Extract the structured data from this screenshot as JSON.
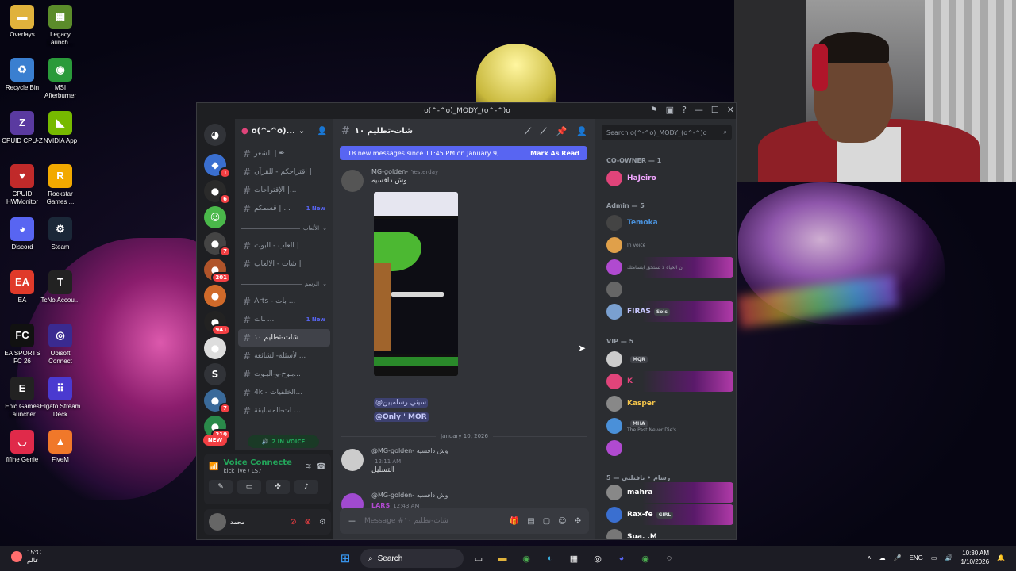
{
  "desktop": {
    "icons": [
      {
        "label": "Overlays",
        "icon": "folder-icon",
        "color": "#e0b23c",
        "glyph": "▬"
      },
      {
        "label": "Legacy Launch...",
        "icon": "minecraft-icon",
        "color": "#5b8c2a",
        "glyph": "▦"
      },
      {
        "label": "Recycle Bin",
        "icon": "recycle-bin-icon",
        "color": "#3a7fd0",
        "glyph": "♻"
      },
      {
        "label": "MSI Afterburner",
        "icon": "afterburner-icon",
        "color": "#2a9a3a",
        "glyph": "◉"
      },
      {
        "label": "CPUID CPU-Z",
        "icon": "cpuz-icon",
        "color": "#5a3aa0",
        "glyph": "Z"
      },
      {
        "label": "NVIDIA App",
        "icon": "nvidia-icon",
        "color": "#76b900",
        "glyph": "◣"
      },
      {
        "label": "CPUID HWMonitor",
        "icon": "hwmonitor-icon",
        "color": "#c02a2a",
        "glyph": "♥"
      },
      {
        "label": "Rockstar Games ...",
        "icon": "rockstar-icon",
        "color": "#f2a900",
        "glyph": "R"
      },
      {
        "label": "Discord",
        "icon": "discord-icon",
        "color": "#5865f2",
        "glyph": "◕"
      },
      {
        "label": "Steam",
        "icon": "steam-icon",
        "color": "#1b2838",
        "glyph": "⚙"
      },
      {
        "label": "EA",
        "icon": "ea-icon",
        "color": "#e03a2a",
        "glyph": "EA"
      },
      {
        "label": "TcNo Accou...",
        "icon": "tcno-icon",
        "color": "#222222",
        "glyph": "T"
      },
      {
        "label": "EA SPORTS FC 26",
        "icon": "fc26-icon",
        "color": "#111111",
        "glyph": "FC"
      },
      {
        "label": "Ubisoft Connect",
        "icon": "ubisoft-icon",
        "color": "#3a2a90",
        "glyph": "◎"
      },
      {
        "label": "Epic Games Launcher",
        "icon": "epic-icon",
        "color": "#222222",
        "glyph": "E"
      },
      {
        "label": "Elgato Stream Deck",
        "icon": "streamdeck-icon",
        "color": "#4a3ad0",
        "glyph": "⠿"
      },
      {
        "label": "fifine Genie",
        "icon": "fifine-icon",
        "color": "#e02a4a",
        "glyph": "◡"
      },
      {
        "label": "FiveM",
        "icon": "fivem-icon",
        "color": "#f0782a",
        "glyph": "▲"
      }
    ]
  },
  "window": {
    "title": "o(^-^o)_MODY_(o^-^)o"
  },
  "guild": {
    "name": "o(^-^o)..."
  },
  "servers": [
    {
      "badge": "1",
      "color": "#3a6fd0",
      "glyph": "◆"
    },
    {
      "badge": "6",
      "color": "#2a2a2a",
      "glyph": "●"
    },
    {
      "badge": "",
      "color": "#4ab84a",
      "glyph": "☺"
    },
    {
      "badge": "7",
      "color": "#444444",
      "glyph": "●"
    },
    {
      "badge": "201",
      "color": "#b0542a",
      "glyph": "●"
    },
    {
      "badge": "",
      "color": "#d06a2a",
      "glyph": "●"
    },
    {
      "badge": "941",
      "color": "#222222",
      "glyph": "●"
    },
    {
      "badge": "",
      "color": "#dddddd",
      "glyph": "●"
    },
    {
      "badge": "",
      "color": "#313338",
      "glyph": "S"
    },
    {
      "badge": "7",
      "color": "#3a6a9a",
      "glyph": "●"
    },
    {
      "badge": "210",
      "color": "#2a8a4a",
      "glyph": "●"
    }
  ],
  "rail_new": "NEW",
  "channels": [
    {
      "name": "الشعر | ✒",
      "active": false,
      "new": ""
    },
    {
      "name": "اقتراحكم - للقرآن |",
      "active": false,
      "new": ""
    },
    {
      "name": "الإقتراحات |...",
      "active": false,
      "new": ""
    },
    {
      "name": "قسمكم | ...",
      "active": false,
      "new": "1 New"
    }
  ],
  "category1": "الألعاب",
  "channels2": [
    {
      "name": "العاب - البوت |",
      "active": false,
      "new": ""
    },
    {
      "name": "شات - الالعاب |",
      "active": false,
      "new": ""
    }
  ],
  "category2": "الرسم",
  "channels3": [
    {
      "name": "Arts - بات ...",
      "active": false,
      "new": ""
    },
    {
      "name": "ـات ...",
      "active": false,
      "new": "1 New"
    },
    {
      "name": "شات-تطليم ١٠",
      "active": true,
      "new": ""
    },
    {
      "name": "الأسئلة-الشائعة...",
      "active": false,
      "new": ""
    },
    {
      "name": "بـوح-و-البـوت...",
      "active": false,
      "new": ""
    },
    {
      "name": "4k - الخلفيات...",
      "active": false,
      "new": ""
    },
    {
      "name": "ـات-المسابقة...",
      "active": false,
      "new": ""
    }
  ],
  "voice_pill": "2 IN VOICE",
  "voice": {
    "title": "Voice Connecte",
    "subtitle": "kick live / LS7"
  },
  "user": {
    "name": "محمد"
  },
  "chat": {
    "channel_name": "شات-تطليم ١٠",
    "new_banner": "18 new messages since 11:45 PM on January 9, ...",
    "mark_read": "Mark As Read",
    "msg1_author": "MG-golden-",
    "msg1_time": "Yesterday",
    "msg1_text": "وش دافسيه",
    "mention1": "@سيني رساميين",
    "mention2": "@Only ' MOR",
    "date_divider": "January 10, 2026",
    "msg2_reply": "@MG-golden- وش دافسيه",
    "msg2_time": "12:11 AM",
    "msg2_text": "التسليل",
    "msg3_reply": "@MG-golden- وش دافسيه",
    "msg3_author": "LARS",
    "msg3_time": "12:43 AM",
    "composer_placeholder": "Message #شات-تطليم ١٠"
  },
  "members": {
    "search_placeholder": "Search o(^-^o)_MODY_(o^-^)o",
    "groups": [
      {
        "label": "CO-OWNER — 1"
      },
      {
        "label": "Admin — 5"
      },
      {
        "label": "VIP — 5"
      },
      {
        "label": "رسام • بافتلتي — 5"
      }
    ],
    "list": [
      {
        "name": "HaJeiro",
        "sub": "",
        "color": "#f2a6ff",
        "tag": "",
        "fancy": false
      },
      {
        "name": "Temoka",
        "sub": "",
        "color": "#4a90d9",
        "tag": "",
        "fancy": false
      },
      {
        "name": "",
        "sub": "In voice",
        "color": "#e0447a",
        "tag": "",
        "fancy": false
      },
      {
        "name": "",
        "sub": "ان الحياة لا تستحق ابتسامتك",
        "color": "#b04ad0",
        "tag": "",
        "fancy": true
      },
      {
        "name": "",
        "sub": "",
        "color": "#b04ad0",
        "tag": "",
        "fancy": false
      },
      {
        "name": "FIRAS",
        "sub": "",
        "color": "#c8c8ff",
        "tag": "Sols",
        "fancy": true
      },
      {
        "name": "",
        "sub": "",
        "color": "#f2c34a",
        "tag": "MQR",
        "fancy": false
      },
      {
        "name": "K",
        "sub": "",
        "color": "#e0447a",
        "tag": "",
        "fancy": true
      },
      {
        "name": "Kasper",
        "sub": "",
        "color": "#f2c34a",
        "tag": "",
        "fancy": false
      },
      {
        "name": "",
        "sub": "The Past Never Die's",
        "color": "#c8c8ff",
        "tag": "MHA",
        "fancy": false
      },
      {
        "name": "",
        "sub": "",
        "color": "#b04ad0",
        "tag": "",
        "fancy": false
      },
      {
        "name": "mahra",
        "sub": "",
        "color": "#ffffff",
        "tag": "",
        "fancy": true
      },
      {
        "name": "Rax-fe",
        "sub": "",
        "color": "#ffffff",
        "tag": "GIRL",
        "fancy": true
      },
      {
        "name": "Sua. .M",
        "sub": "",
        "color": "#ffffff",
        "tag": "",
        "fancy": false
      }
    ]
  },
  "taskbar": {
    "temp": "15°C",
    "weather_label": "عالم",
    "search_label": "Search",
    "lang": "ENG",
    "time": "10:30 AM",
    "date": "1/10/2026"
  }
}
